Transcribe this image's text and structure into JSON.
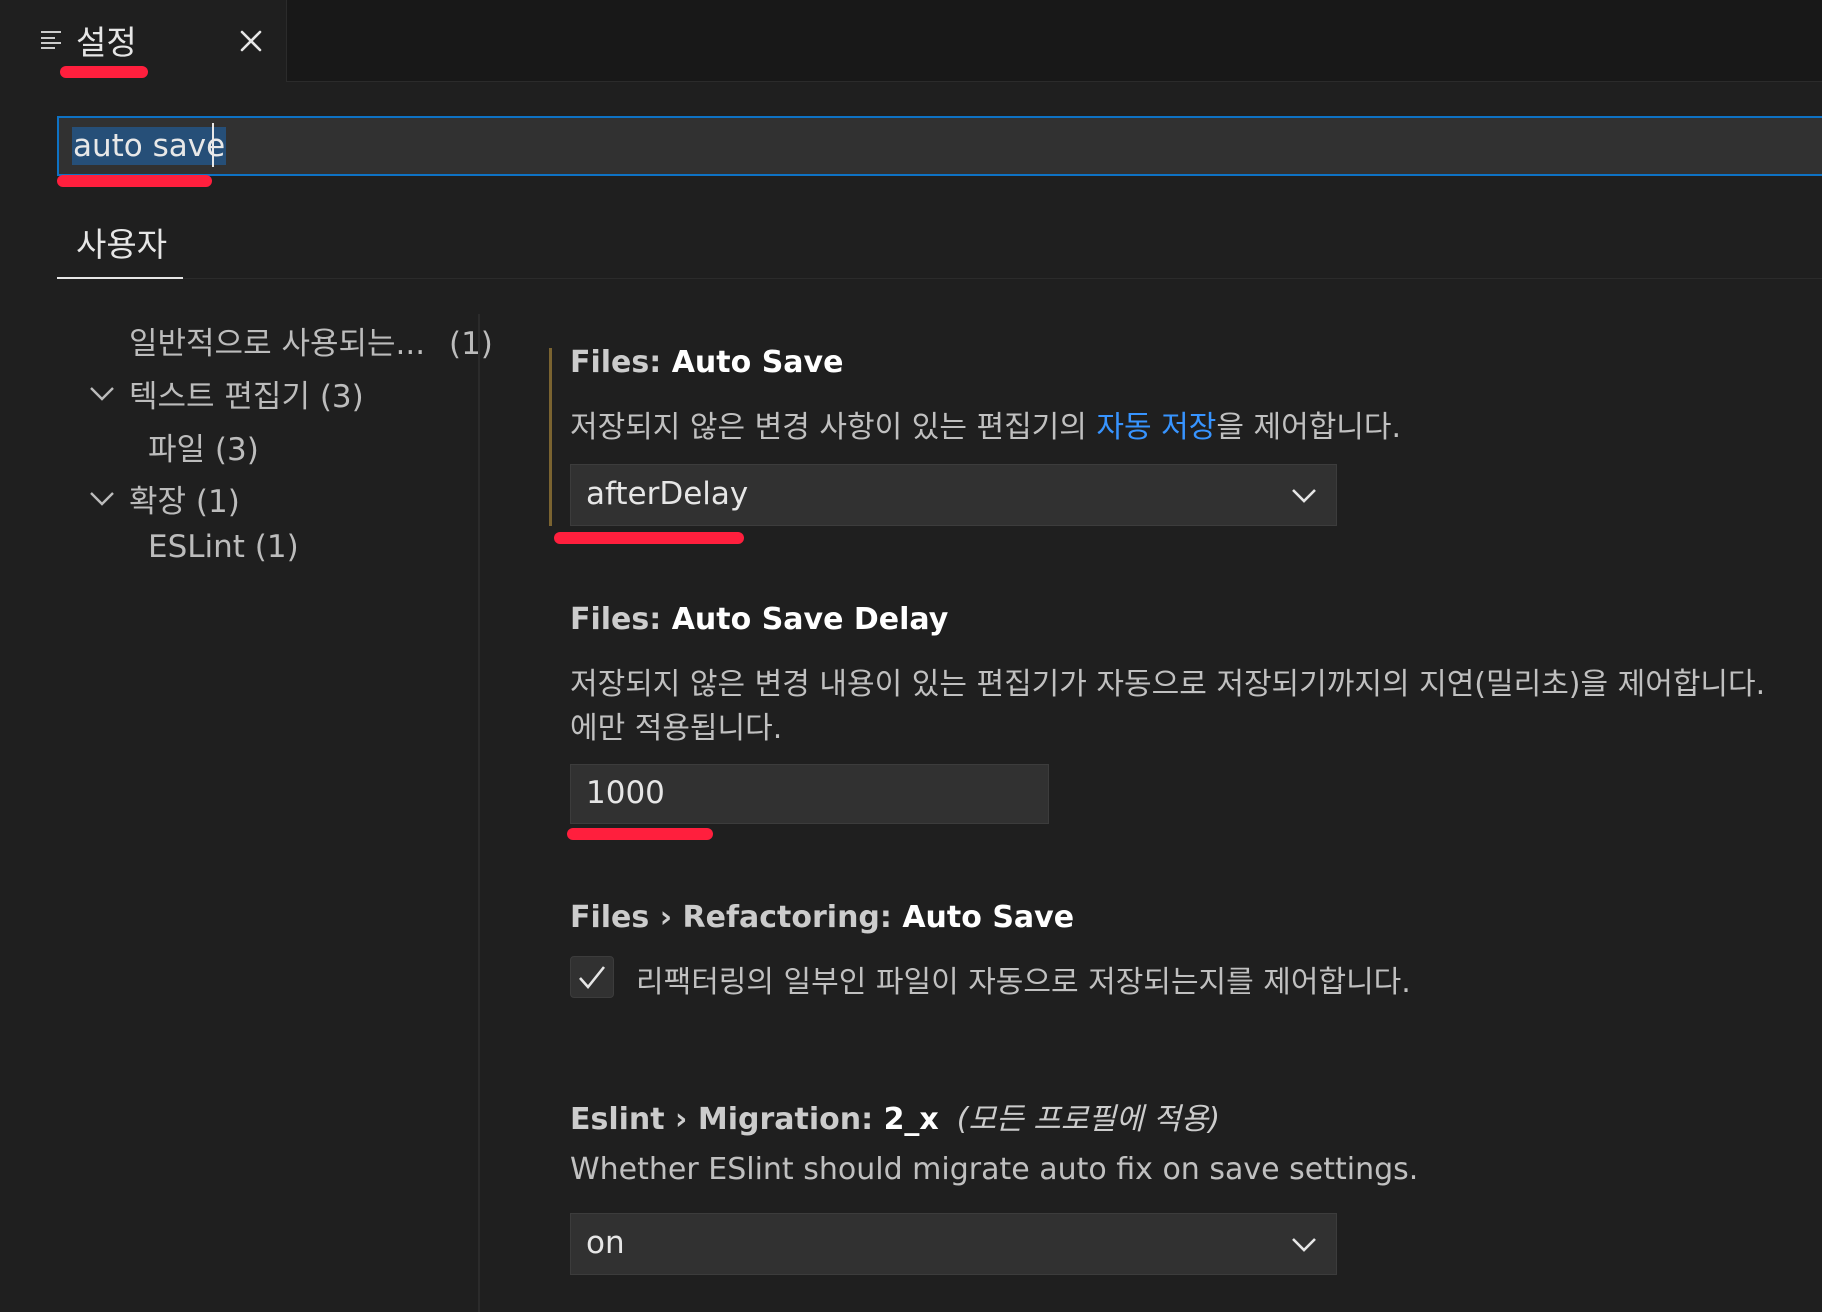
{
  "tab": {
    "title": "설정",
    "icon": "settings-list-icon",
    "close_icon": "close-icon"
  },
  "search": {
    "value": "auto save"
  },
  "scope_tabs": [
    {
      "label": "사용자"
    }
  ],
  "toc": {
    "items": [
      {
        "label": "일반적으로 사용되는...",
        "count": "(1)"
      },
      {
        "label": "텍스트 편집기 (3)",
        "expanded": true
      },
      {
        "label": "파일 (3)"
      },
      {
        "label": "확장 (1)",
        "expanded": true
      },
      {
        "label": "ESLint (1)"
      }
    ]
  },
  "settings": [
    {
      "category": "Files: ",
      "key": "Auto Save",
      "description_before": "저장되지 않은 변경 사항이 있는 편집기의 ",
      "description_link": "자동 저장",
      "description_after": "을 제어합니다.",
      "value": "afterDelay"
    },
    {
      "category": "Files: ",
      "key": "Auto Save Delay",
      "description_line1": "저장되지 않은 변경 내용이 있는 편집기가 자동으로 저장되기까지의 지연(밀리초)을 제어합니다.",
      "description_line2": "에만 적용됩니다.",
      "value": "1000"
    },
    {
      "category": "Files › Refactoring: ",
      "key": "Auto Save",
      "checked": true,
      "description": "리팩터링의 일부인 파일이 자동으로 저장되는지를 제어합니다."
    },
    {
      "category": "Eslint › Migration: ",
      "key": "2_x",
      "scope": "(모든 프로필에 적용)",
      "description": "Whether ESlint should migrate auto fix on save settings.",
      "value": "on"
    }
  ],
  "colors": {
    "accent": "#0e72c4",
    "link": "#3794ff",
    "annotation": "#ff1f3d",
    "background": "#1f1f1f"
  }
}
